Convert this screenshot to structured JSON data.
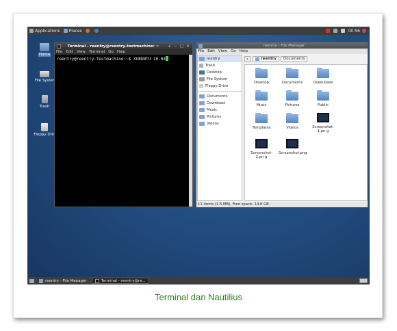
{
  "caption": "Terminal dan Nautilius",
  "top_panel": {
    "applications": "Applications",
    "places": "Places",
    "clock": "00:56"
  },
  "desktop_icons": [
    {
      "label": "Home",
      "icon": "home-folder-icon"
    },
    {
      "label": "File Syster",
      "icon": "drive-icon"
    },
    {
      "label": "Trash",
      "icon": "trash-icon"
    },
    {
      "label": "Floppy Driv",
      "icon": "floppy-icon"
    }
  ],
  "terminal": {
    "title": "Terminal - reentry@reentry-testmachine: ~",
    "menu": [
      "File",
      "Edit",
      "View",
      "Terminal",
      "Go",
      "Help"
    ],
    "prompt": "reentry@reentry-testmachine:~$ XUBUNTU 10.04"
  },
  "file_manager": {
    "title": "reentry - File Manager",
    "menu": [
      "File",
      "Edit",
      "View",
      "Go",
      "Help"
    ],
    "sidebar": [
      "reentry",
      "Trash",
      "Desktop",
      "File System",
      "Floppy Drive",
      "Documents",
      "Download",
      "Music",
      "Pictures",
      "Videos"
    ],
    "breadcrumbs": [
      "reentry",
      "Documents"
    ],
    "files": [
      {
        "name": "Desktop",
        "kind": "folder"
      },
      {
        "name": "Documents",
        "kind": "folder"
      },
      {
        "name": "Downloads",
        "kind": "folder"
      },
      {
        "name": "Music",
        "kind": "folder"
      },
      {
        "name": "Pictures",
        "kind": "folder"
      },
      {
        "name": "Public",
        "kind": "folder"
      },
      {
        "name": "Templates",
        "kind": "folder"
      },
      {
        "name": "Videos",
        "kind": "folder"
      },
      {
        "name": "Screenshot-1.pn g",
        "kind": "image"
      },
      {
        "name": "Screenshot-2.pn g",
        "kind": "image"
      },
      {
        "name": "Screenshot.png",
        "kind": "image"
      }
    ],
    "status": "11 items (1.5 MB), Free space: 14.8 GB"
  },
  "taskbar": [
    {
      "label": "reentry - File Manager",
      "active": false
    },
    {
      "label": "Terminal - reentry@re...",
      "active": true
    }
  ]
}
